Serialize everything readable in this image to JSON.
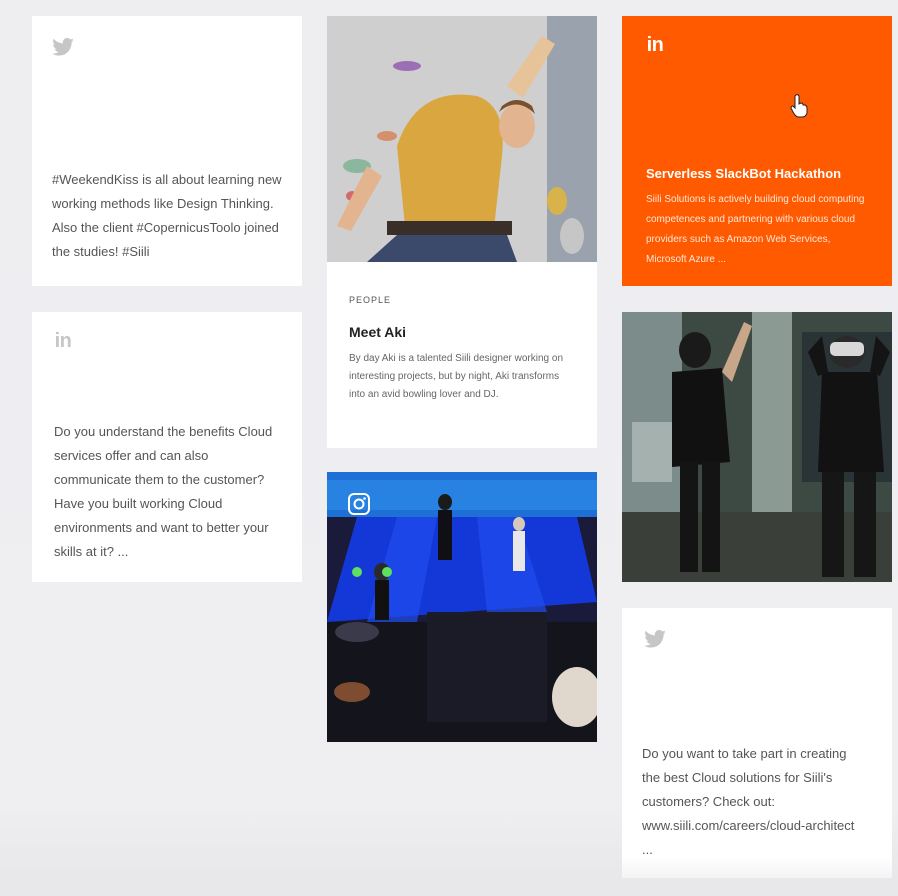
{
  "colors": {
    "background": "#eeeef1",
    "card": "#ffffff",
    "accent_orange": "#ff5a00",
    "icon_gray": "#c6c6c6"
  },
  "icons": {
    "twitter": "twitter-icon",
    "linkedin": "linkedin-icon",
    "instagram": "instagram-icon"
  },
  "cards": {
    "twitter_1": {
      "text": "#WeekendKiss is all about learning new working methods like Design Thinking. Also the client #CopernicusToolo joined the studies! #Siili"
    },
    "linkedin_1": {
      "text": "Do you understand the benefits Cloud services offer and can also communicate them to the customer? Have you built working Cloud environments and want to better your skills at it? ..."
    },
    "article": {
      "category": "PEOPLE",
      "title": "Meet Aki",
      "body": "By day Aki is a talented Siili designer working on interesting projects, but by night, Aki transforms into an avid bowling lover and DJ."
    },
    "linkedin_featured": {
      "title": "Serverless SlackBot Hackathon",
      "body": "Siili Solutions is actively building cloud computing competences and partnering with various cloud providers such as Amazon Web Services, Microsoft Azure ..."
    },
    "twitter_2": {
      "text": "Do you want to take part in creating the best Cloud solutions for Siili's customers? Check out: www.siili.com/careers/cloud-architect ..."
    }
  }
}
